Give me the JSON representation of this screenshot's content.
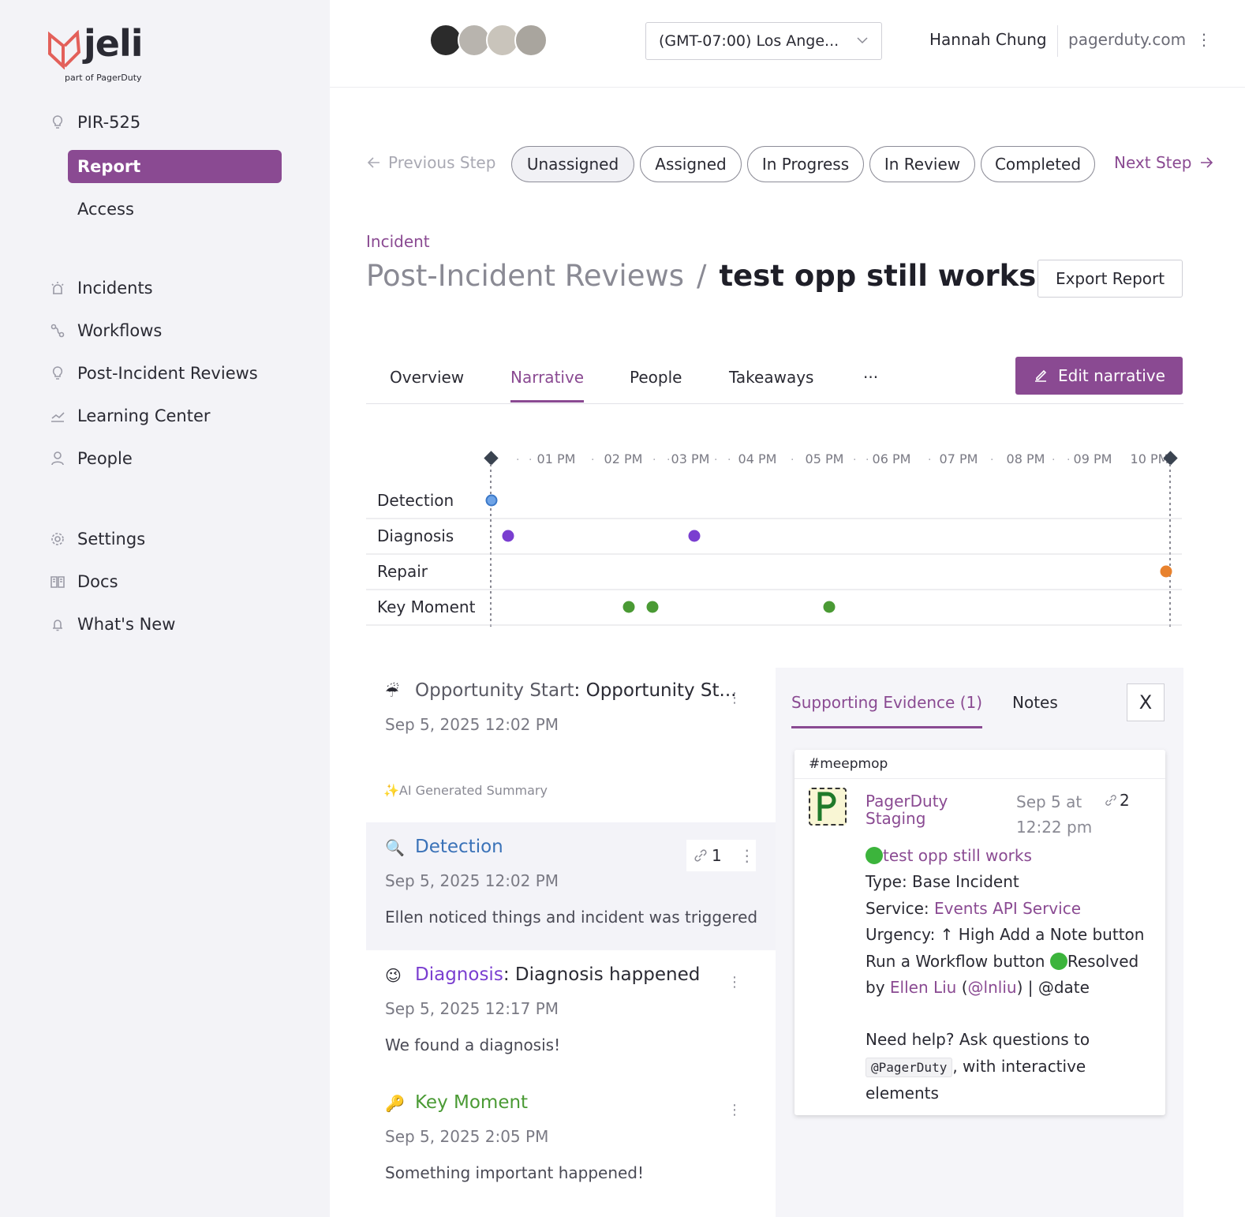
{
  "sidebar": {
    "logo_text": "jeli",
    "logo_sub": "part of PagerDuty",
    "pir_id": "PIR-525",
    "sub_items": [
      "Report",
      "Access"
    ],
    "nav": [
      {
        "label": "Incidents",
        "icon": "alarm-icon"
      },
      {
        "label": "Workflows",
        "icon": "workflow-icon"
      },
      {
        "label": "Post-Incident Reviews",
        "icon": "lightbulb-icon"
      },
      {
        "label": "Learning Center",
        "icon": "chart-line-icon"
      },
      {
        "label": "People",
        "icon": "person-icon"
      },
      {
        "label": "Settings",
        "icon": "gear-icon"
      },
      {
        "label": "Docs",
        "icon": "book-icon"
      },
      {
        "label": "What's New",
        "icon": "bell-icon"
      }
    ]
  },
  "header": {
    "timezone": "(GMT-07:00) Los Ange...",
    "user_name": "Hannah Chung",
    "domain": "pagerduty.com",
    "avatar_colors": [
      "#2b2b2b",
      "#b8b4ae",
      "#c9c4bb",
      "#a9a59e"
    ]
  },
  "steps": {
    "prev": "Previous Step",
    "next": "Next Step",
    "items": [
      "Unassigned",
      "Assigned",
      "In Progress",
      "In Review",
      "Completed"
    ],
    "current": "Unassigned"
  },
  "title": {
    "crumb": "Incident",
    "section": "Post-Incident Reviews",
    "separator": "/",
    "name": "test opp still works",
    "export": "Export Report"
  },
  "tabs": {
    "items": [
      "Overview",
      "Narrative",
      "People",
      "Takeaways",
      "···"
    ],
    "active": "Narrative",
    "edit": "Edit narrative"
  },
  "timeline": {
    "ticks": [
      "01 PM",
      "02 PM",
      "03 PM",
      "04 PM",
      "05 PM",
      "06 PM",
      "07 PM",
      "08 PM",
      "09 PM",
      "10 PM"
    ],
    "rows": [
      {
        "label": "Detection",
        "color": "#4a90d9"
      },
      {
        "label": "Diagnosis",
        "color": "#7a3ed0"
      },
      {
        "label": "Repair",
        "color": "#e8822e"
      },
      {
        "label": "Key Moment",
        "color": "#4a9a34"
      }
    ]
  },
  "entries": {
    "start": {
      "emoji": "☔",
      "label": "Opportunity Start",
      "text": ": Opportunity St...",
      "date": "Sep 5, 2025 12:02 PM"
    },
    "ai_summary": "✨AI Generated Summary",
    "detection": {
      "emoji": "🔍",
      "label": "Detection",
      "date": "Sep 5, 2025 12:02 PM",
      "desc": "Ellen noticed things and incident was triggered",
      "links": "1"
    },
    "diagnosis": {
      "emoji": "😉",
      "label": "Diagnosis",
      "text": ": Diagnosis happened",
      "date": "Sep 5, 2025 12:17 PM",
      "desc": "We found a diagnosis!"
    },
    "key": {
      "emoji": "🔑",
      "label": "Key Moment",
      "date": "Sep 5, 2025 2:05 PM",
      "desc": "Something important happened!"
    }
  },
  "panel": {
    "tab_evidence": "Supporting Evidence (1)",
    "tab_notes": "Notes",
    "close": "X",
    "channel": "#meepmop",
    "sender": "PagerDuty Staging",
    "time": "Sep 5 at 12:22 pm",
    "links": "2",
    "incident": "test opp still works",
    "type_line": "Type: Base Incident",
    "service_prefix": "Service: ",
    "service": "Events API Service",
    "urgency": "Urgency: ↑ High Add a Note button Run a Workflow button",
    "resolved": "Resolved",
    "by": "by ",
    "user": "Ellen Liu",
    "handle_open": " (",
    "handle": "@lnliu",
    "handle_close": ") | @date",
    "help_1": "Need help? Ask questions to",
    "help_code": "@PagerDuty",
    "help_2": ", with interactive elements"
  }
}
